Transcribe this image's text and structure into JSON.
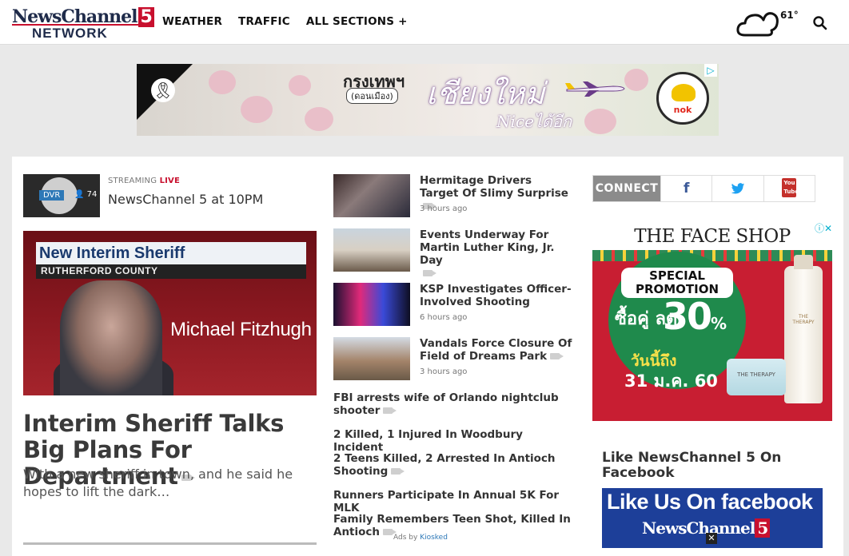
{
  "header": {
    "logo_line1": "NewsChannel",
    "logo_five": "5",
    "logo_line2": "NETWORK",
    "nav": [
      "WEATHER",
      "TRAFFIC",
      "ALL SECTIONS +"
    ],
    "temperature": "61°"
  },
  "top_ad": {
    "line1": "กรุงเทพฯ",
    "line2": "(ดอนเมือง)",
    "line3": "เชียงใหม่",
    "line4": "Niceได้อีก",
    "brand": "nok"
  },
  "live": {
    "dvr": "DVR",
    "viewers": "74",
    "label_prefix": "STREAMING",
    "label_live": "LIVE",
    "title": "NewsChannel 5 at 10PM"
  },
  "hero": {
    "lower_third": "New Interim Sheriff",
    "lower_sub": "RUTHERFORD COUNTY",
    "name_caption": "Michael Fitzhugh",
    "headline": "Interim Sheriff Talks Big Plans For Department",
    "description": "With a new sheriff in town, and he said he hopes to lift the dark…"
  },
  "stories": [
    {
      "title": "Hermitage Drivers Target Of Slimy Surprise",
      "time": "3 hours ago"
    },
    {
      "title": "Events Underway For Martin Luther King, Jr. Day",
      "time": ""
    },
    {
      "title": "KSP Investigates Officer-Involved Shooting",
      "time": "6 hours ago"
    },
    {
      "title": "Vandals Force Closure Of Field of Dreams Park",
      "time": "3 hours ago"
    }
  ],
  "links": [
    "FBI arrests wife of Orlando nightclub shooter",
    "2 Killed, 1 Injured In Woodbury Incident",
    "2 Teens Killed, 2 Arrested In Antioch Shooting",
    "Runners Participate In Annual 5K For MLK",
    "Family Remembers Teen Shot, Killed In Antioch"
  ],
  "ads_by": {
    "prefix": "Ads by",
    "name": "Kiosked"
  },
  "connect": {
    "label": "CONNECT",
    "facebook": "f",
    "twitter": "t",
    "youtube": "You Tube"
  },
  "face_ad": {
    "brand": "THE FACE SHOP",
    "promo": "SPECIAL PROMOTION",
    "thai1": "ซื้อคู่ ลด",
    "pct": "30",
    "pct_sign": "%",
    "thai2": "วันนี้ถึง",
    "thai3": "31 ม.ค. 60",
    "product": "THE THERAPY"
  },
  "facebook_block": {
    "heading": "Like NewsChannel 5 On Facebook",
    "box_line1": "Like Us On facebook",
    "box_line2": "NewsChannel",
    "box_five": "5"
  },
  "colors": {
    "brand_red": "#c8102e",
    "navy": "#1f2b4a",
    "facebook_blue": "#1d3f99"
  }
}
